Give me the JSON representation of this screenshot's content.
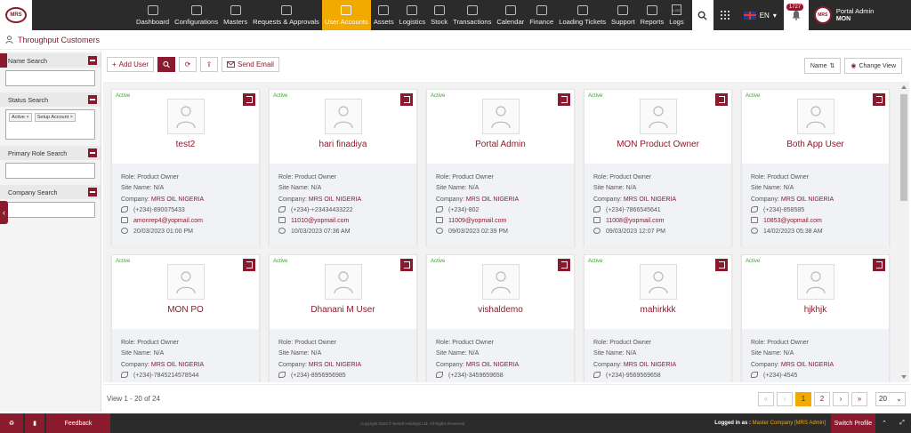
{
  "nav": {
    "items": [
      "Dashboard",
      "Configurations",
      "Masters",
      "Requests & Approvals",
      "User Accounts",
      "Assets",
      "Logistics",
      "Stock",
      "Transactions",
      "Calendar",
      "Finance",
      "Loading Tickets",
      "Support",
      "Reports",
      "Logs"
    ],
    "active_index": 4,
    "logo_text": "MRS",
    "logs_icon_text": "LOG",
    "language": "EN",
    "notification_count": "1727",
    "profile_name": "Portal Admin",
    "profile_org": "MON"
  },
  "breadcrumb": {
    "title": "Throughput Customers"
  },
  "sidebar": {
    "name_search": "Name Search",
    "status_search": "Status Search",
    "status_tags": [
      "Active",
      "Setup Account"
    ],
    "primary_role_search": "Primary Role Search",
    "company_search": "Company Search"
  },
  "toolbar": {
    "add_user": "Add User",
    "send_email": "Send Email",
    "sort_label": "Name",
    "change_view": "Change View"
  },
  "users": [
    {
      "status": "Active",
      "name": "test2",
      "role": "Role: Product Owner",
      "site": "Site Name: N/A",
      "company_label": "Company: ",
      "company": "MRS OIL NIGERIA",
      "phone": "(+234)-890075433",
      "email": "amonrep4@yopmail.com",
      "date": "20/03/2023 01:00 PM"
    },
    {
      "status": "Active",
      "name": "hari finadiya",
      "role": "Role: Product Owner",
      "site": "Site Name: N/A",
      "company_label": "Company: ",
      "company": "MRS OIL NIGERIA",
      "phone": "(+234)-+23434433222",
      "email": "11010@yopmail.com",
      "date": "10/03/2023 07:36 AM"
    },
    {
      "status": "Active",
      "name": "Portal Admin",
      "role": "Role: Product Owner",
      "site": "Site Name: N/A",
      "company_label": "Company: ",
      "company": "MRS OIL NIGERIA",
      "phone": "(+234)-802",
      "email": "11009@yopmail.com",
      "date": "09/03/2023 02:39 PM"
    },
    {
      "status": "Active",
      "name": "MON Product Owner",
      "role": "Role: Product Owner",
      "site": "Site Name: N/A",
      "company_label": "Company: ",
      "company": "MRS OIL NIGERIA",
      "phone": "(+234)-7866545641",
      "email": "11008@yopmail.com",
      "date": "09/03/2023 12:07 PM"
    },
    {
      "status": "Active",
      "name": "Both App User",
      "role": "Role: Product Owner",
      "site": "Site Name: N/A",
      "company_label": "Company: ",
      "company": "MRS OIL NIGERIA",
      "phone": "(+234)-858585",
      "email": "10853@yopmail.com",
      "date": "14/02/2023 05:38 AM"
    },
    {
      "status": "Active",
      "name": "MON PO",
      "role": "Role: Product Owner",
      "site": "Site Name: N/A",
      "company_label": "Company: ",
      "company": "MRS OIL NIGERIA",
      "phone": "(+234)-7845214578544",
      "email": "",
      "date": ""
    },
    {
      "status": "Active",
      "name": "Dhanani M User",
      "role": "Role: Product Owner",
      "site": "Site Name: N/A",
      "company_label": "Company: ",
      "company": "MRS OIL NIGERIA",
      "phone": "(+234)-8956956985",
      "email": "",
      "date": ""
    },
    {
      "status": "Active",
      "name": "vishaldemo",
      "role": "Role: Product Owner",
      "site": "Site Name: N/A",
      "company_label": "Company: ",
      "company": "MRS OIL NIGERIA",
      "phone": "(+234)-3459659658",
      "email": "",
      "date": ""
    },
    {
      "status": "Active",
      "name": "mahirkkk",
      "role": "Role: Product Owner",
      "site": "Site Name: N/A",
      "company_label": "Company: ",
      "company": "MRS OIL NIGERIA",
      "phone": "(+234)-9569569658",
      "email": "",
      "date": ""
    },
    {
      "status": "Active",
      "name": "hjkhjk",
      "role": "Role: Product Owner",
      "site": "Site Name: N/A",
      "company_label": "Company: ",
      "company": "MRS OIL NIGERIA",
      "phone": "(+234)-4545",
      "email": "",
      "date": ""
    }
  ],
  "pagination": {
    "view_text": "View 1 - 20 of 24",
    "first": "«",
    "prev": "‹",
    "pages": [
      "1",
      "2"
    ],
    "current": "1",
    "next": "›",
    "last": "»",
    "per_page": "20"
  },
  "footer": {
    "feedback": "Feedback",
    "copyright": "Copyright 2023 © Bestaf Holdings Ltd. All Rights Reserved",
    "logged_label": "Logged in as : ",
    "logged_value": "Master Company [MRS Admin]",
    "switch_profile": "Switch Profile"
  }
}
